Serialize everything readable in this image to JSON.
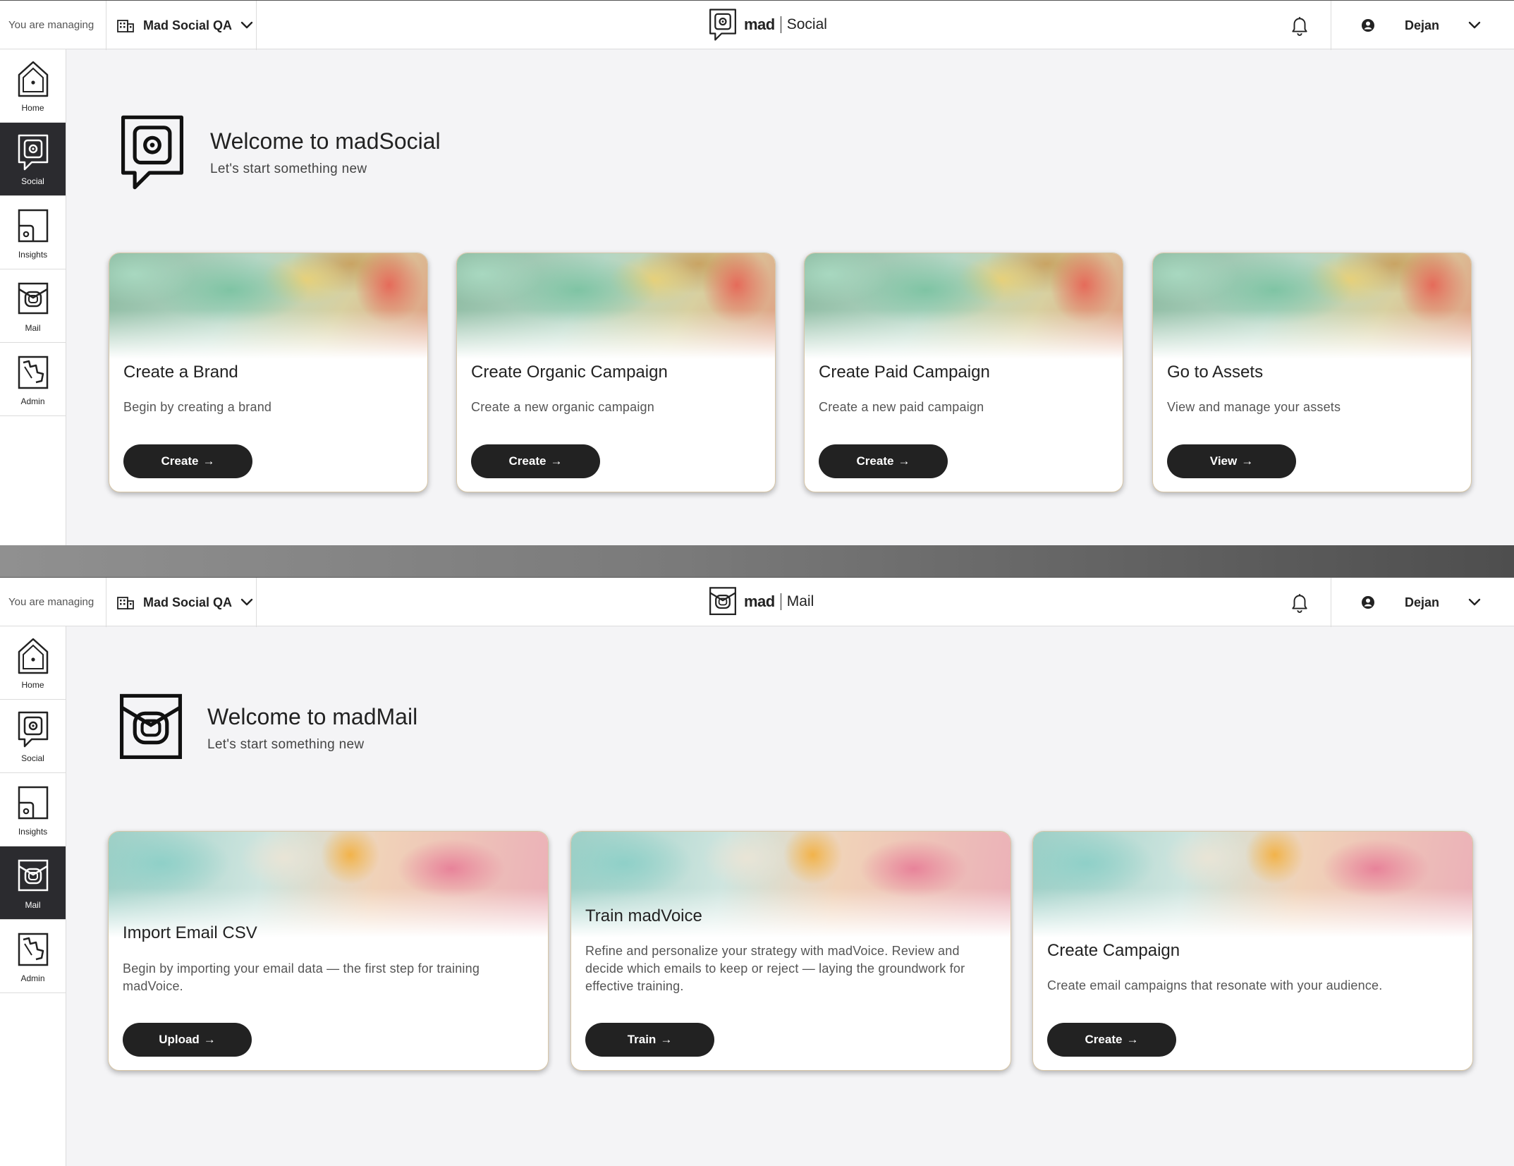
{
  "social": {
    "header": {
      "managing_label": "You are managing",
      "org_name": "Mad Social QA",
      "logo_mad": "mad",
      "logo_product": "Social",
      "user_name": "Dejan"
    },
    "sidebar": {
      "items": [
        {
          "label": "Home",
          "icon": "home-icon",
          "active": false
        },
        {
          "label": "Social",
          "icon": "social-icon",
          "active": true
        },
        {
          "label": "Insights",
          "icon": "insights-icon",
          "active": false
        },
        {
          "label": "Mail",
          "icon": "mail-icon",
          "active": false
        },
        {
          "label": "Admin",
          "icon": "admin-icon",
          "active": false
        }
      ]
    },
    "hero": {
      "title": "Welcome to madSocial",
      "subtitle": "Let's start something new"
    },
    "cards": [
      {
        "title": "Create a Brand",
        "description": "Begin by creating a brand",
        "button": "Create"
      },
      {
        "title": "Create Organic Campaign",
        "description": "Create a new organic campaign",
        "button": "Create"
      },
      {
        "title": "Create Paid Campaign",
        "description": "Create a new paid campaign",
        "button": "Create"
      },
      {
        "title": "Go to Assets",
        "description": "View and manage your assets",
        "button": "View"
      }
    ]
  },
  "mail": {
    "header": {
      "managing_label": "You are managing",
      "org_name": "Mad Social QA",
      "logo_mad": "mad",
      "logo_product": "Mail",
      "user_name": "Dejan"
    },
    "sidebar": {
      "items": [
        {
          "label": "Home",
          "icon": "home-icon",
          "active": false
        },
        {
          "label": "Social",
          "icon": "social-icon",
          "active": false
        },
        {
          "label": "Insights",
          "icon": "insights-icon",
          "active": false
        },
        {
          "label": "Mail",
          "icon": "mail-icon",
          "active": true
        },
        {
          "label": "Admin",
          "icon": "admin-icon",
          "active": false
        }
      ]
    },
    "hero": {
      "title": "Welcome to madMail",
      "subtitle": "Let's start something new"
    },
    "cards": [
      {
        "title": "Import Email CSV",
        "description": "Begin by importing your email data — the first step for training madVoice.",
        "button": "Upload"
      },
      {
        "title": "Train madVoice",
        "description": "Refine and personalize your strategy with madVoice. Review and decide which emails to keep or reject — laying the groundwork for effective training.",
        "button": "Train"
      },
      {
        "title": "Create Campaign",
        "description": "Create email campaigns that resonate with your audience.",
        "button": "Create"
      }
    ]
  },
  "colors": {
    "primary_button": "#222222",
    "active_nav": "#2b2b2f",
    "background": "#f4f4f6"
  }
}
